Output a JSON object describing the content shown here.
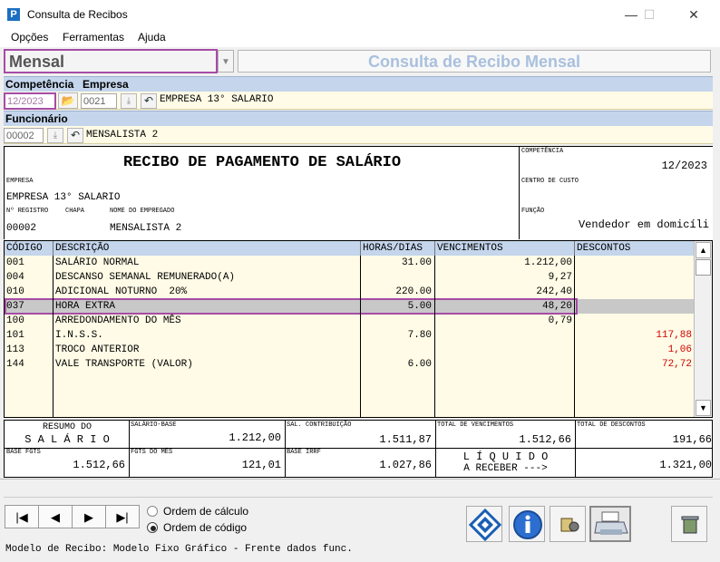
{
  "window": {
    "title": "Consulta de Recibos",
    "minimize": "—",
    "maximize": "☐",
    "close": "✕",
    "icon": "P"
  },
  "menu": [
    "Opções",
    "Ferramentas",
    "Ajuda"
  ],
  "type_combo": {
    "value": "Mensal"
  },
  "banner": "Consulta de Recibo Mensal",
  "filters": {
    "competencia_label": "Competência",
    "empresa_label": "Empresa",
    "competencia_value": "12/2023",
    "empresa_code": "0021",
    "empresa_name": "EMPRESA 13° SALARIO",
    "funcionario_label": "Funcionário",
    "funcionario_code": "00002",
    "funcionario_name": "MENSALISTA 2"
  },
  "recibo": {
    "title": "RECIBO DE PAGAMENTO DE SALÁRIO",
    "competencia_label": "COMPETÊNCIA",
    "competencia": "12/2023",
    "empresa_label": "EMPRESA",
    "empresa": "EMPRESA 13° SALARIO",
    "centro_custo_label": "CENTRO DE CUSTO",
    "centro_custo": "",
    "registro_label": "Nº REGISTRO",
    "registro": "00002",
    "chapa_label": "CHAPA",
    "chapa": "",
    "empregado_label": "NOME DO EMPREGADO",
    "empregado": "MENSALISTA 2",
    "funcao_label": "FUNÇÃO",
    "funcao": "Vendedor em domicíli"
  },
  "grid": {
    "headers": [
      "CÓDIGO",
      "DESCRIÇÃO",
      "HORAS/DIAS",
      "VENCIMENTOS",
      "DESCONTOS"
    ],
    "rows": [
      {
        "code": "001",
        "desc": "SALÁRIO NORMAL",
        "hours": "31.00",
        "venc": "1.212,00",
        "desc_val": ""
      },
      {
        "code": "004",
        "desc": "DESCANSO SEMANAL REMUNERADO(A)",
        "hours": "",
        "venc": "9,27",
        "desc_val": ""
      },
      {
        "code": "010",
        "desc": "ADICIONAL NOTURNO  20%",
        "hours": "220.00",
        "venc": "242,40",
        "desc_val": ""
      },
      {
        "code": "037",
        "desc": "HORA EXTRA",
        "hours": "5.00",
        "venc": "48,20",
        "desc_val": ""
      },
      {
        "code": "100",
        "desc": "ARREDONDAMENTO DO MÊS",
        "hours": "",
        "venc": "0,79",
        "desc_val": ""
      },
      {
        "code": "101",
        "desc": "I.N.S.S.",
        "hours": "7.80",
        "venc": "",
        "desc_val": "117,88"
      },
      {
        "code": "113",
        "desc": "TROCO ANTERIOR",
        "hours": "",
        "venc": "",
        "desc_val": "1,06"
      },
      {
        "code": "144",
        "desc": "VALE TRANSPORTE (VALOR)",
        "hours": "6.00",
        "venc": "",
        "desc_val": "72,72"
      }
    ],
    "selected_row": 3
  },
  "summary": {
    "resumo_line1": "RESUMO DO",
    "resumo_line2": "S A L Á R I O",
    "salario_base_label": "SALÁRIO-BASE",
    "salario_base": "1.212,00",
    "sal_contrib_label": "SAL. CONTRIBUIÇÃO",
    "sal_contrib": "1.511,87",
    "total_venc_label": "TOTAL DE VENCIMENTOS",
    "total_venc": "1.512,66",
    "total_desc_label": "TOTAL DE DESCONTOS",
    "total_desc": "191,66",
    "base_fgts_label": "BASE FGTS",
    "base_fgts": "1.512,66",
    "fgts_mes_label": "FGTS DO MÊS",
    "fgts_mes": "121,01",
    "base_irrf_label": "BASE IRRF",
    "base_irrf": "1.027,86",
    "liquido_line1": "L Í Q U I D O",
    "liquido_line2": "A RECEBER --->",
    "liquido": "1.321,00"
  },
  "nav": {
    "first": "|◀",
    "prev": "◀",
    "next": "▶",
    "last": "▶|"
  },
  "ordering": {
    "option1": "Ordem de cálculo",
    "option2": "Ordem de código",
    "selected": 2
  },
  "status": "Modelo de Recibo: Modelo Fixo Gráfico - Frente dados func.",
  "colors": {
    "header_blue": "#c4d5ec",
    "row_yellow": "#fffbe6",
    "selected_gray": "#c8c8c8",
    "selection_border": "#a64ca6",
    "discount_red": "#d00000"
  }
}
